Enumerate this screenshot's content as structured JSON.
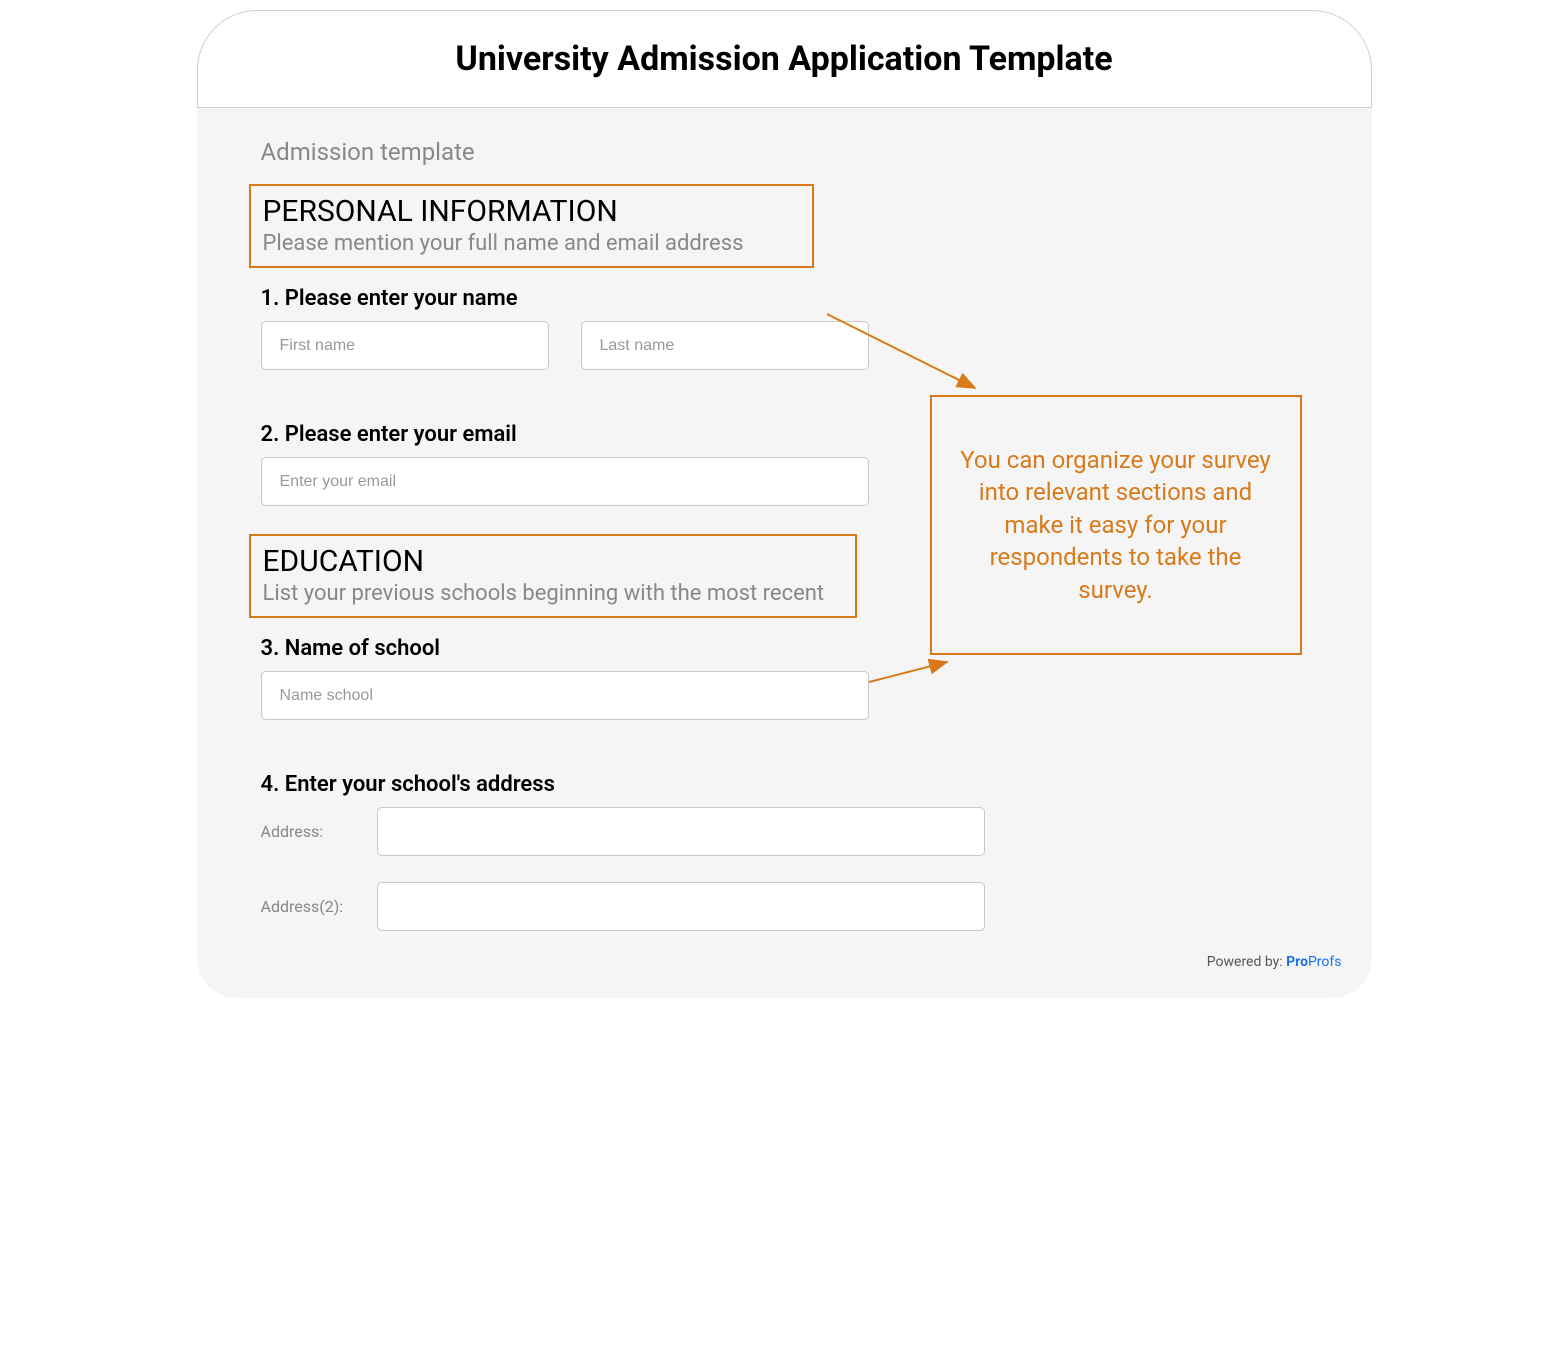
{
  "header": {
    "title": "University Admission Application Template"
  },
  "body": {
    "subtitle": "Admission template"
  },
  "sections": {
    "personal": {
      "title": "PERSONAL INFORMATION",
      "desc": "Please mention your full name and email address"
    },
    "education": {
      "title": "EDUCATION",
      "desc": "List your previous schools beginning with the most recent"
    }
  },
  "questions": {
    "q1": {
      "label": "1. Please enter your name",
      "first_name_placeholder": "First name",
      "last_name_placeholder": "Last name"
    },
    "q2": {
      "label": "2. Please enter your email",
      "email_placeholder": "Enter your email"
    },
    "q3": {
      "label": "3. Name of school",
      "school_placeholder": "Name school"
    },
    "q4": {
      "label": "4. Enter your school's address",
      "address1_label": "Address:",
      "address2_label": "Address(2):"
    }
  },
  "callout": {
    "text": "You can organize your survey into relevant sections and make it easy for your respondents to take the survey."
  },
  "footer": {
    "powered_label": "Powered by: ",
    "brand_pro": "Pro",
    "brand_profs": "Profs"
  },
  "colors": {
    "accent": "#d97a1a",
    "muted": "#888",
    "border": "#c8c8c8",
    "body_bg": "#f5f5f5"
  }
}
